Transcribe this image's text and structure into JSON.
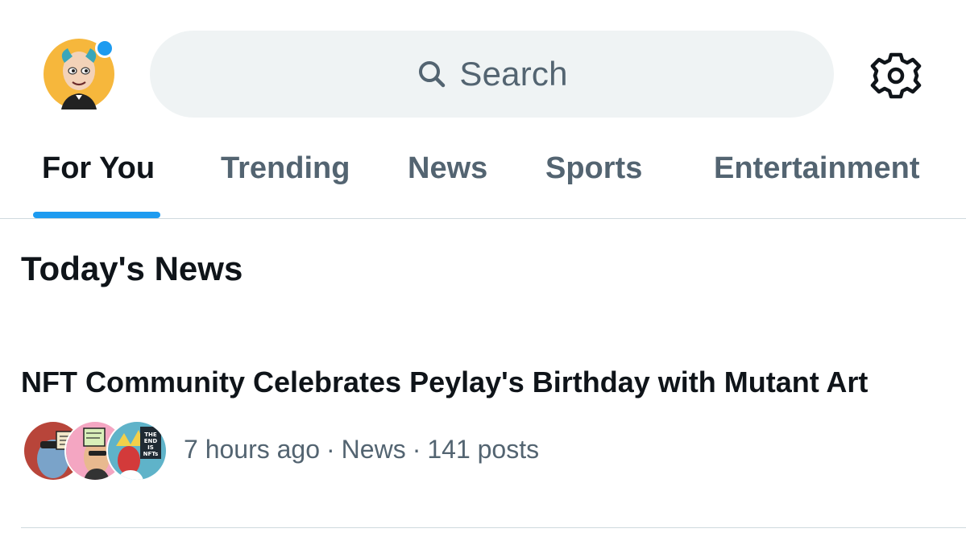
{
  "header": {
    "search_placeholder": "Search",
    "icons": {
      "avatar": "profile-avatar",
      "notification": "notification-dot",
      "search": "search-icon",
      "settings": "gear-icon"
    }
  },
  "tabs": [
    {
      "label": "For You",
      "active": true
    },
    {
      "label": "Trending",
      "active": false
    },
    {
      "label": "News",
      "active": false
    },
    {
      "label": "Sports",
      "active": false
    },
    {
      "label": "Entertainment",
      "active": false
    }
  ],
  "section": {
    "title": "Today's News"
  },
  "news_items": [
    {
      "headline": "NFT Community Celebrates Peylay's Birthday with Mutant Art",
      "time": "7 hours ago",
      "separator": "·",
      "category": "News",
      "posts": "141 posts"
    }
  ],
  "colors": {
    "accent": "#1d9bf0",
    "text_primary": "#0f1419",
    "text_secondary": "#536471",
    "search_bg": "#eff3f4",
    "divider": "#cfd9de"
  }
}
